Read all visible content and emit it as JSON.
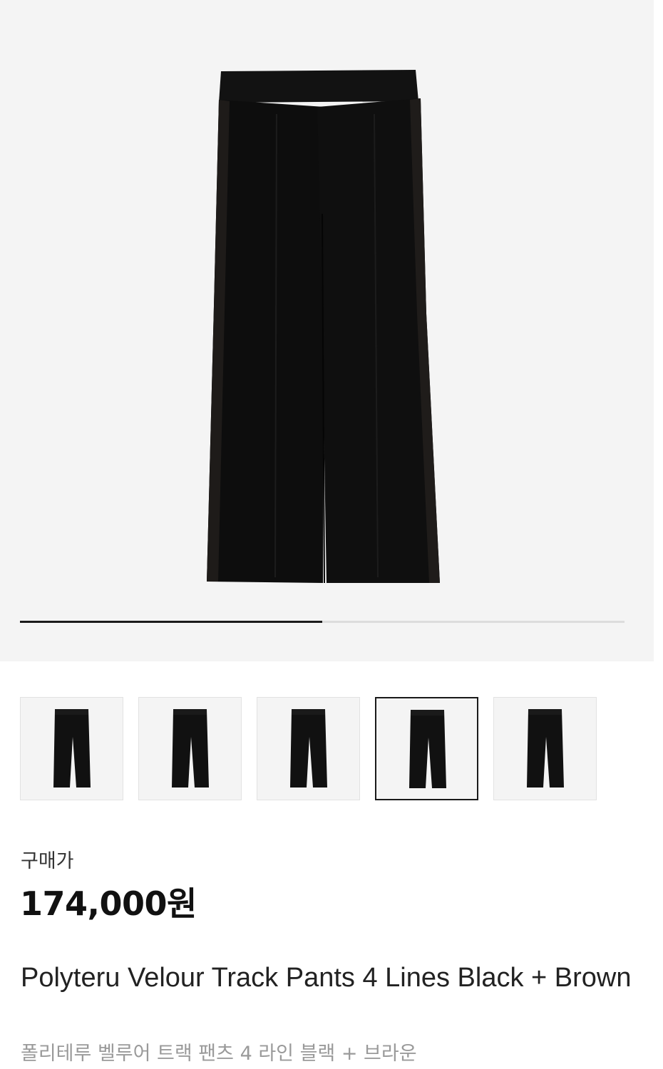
{
  "gallery": {
    "main_image_icon": "pants-product-photo",
    "progress": 0.5,
    "thumbnails": [
      {
        "icon": "pants-thumbnail",
        "selected": false
      },
      {
        "icon": "pants-thumbnail",
        "selected": false
      },
      {
        "icon": "pants-thumbnail",
        "selected": false
      },
      {
        "icon": "pants-thumbnail",
        "selected": true
      },
      {
        "icon": "pants-thumbnail",
        "selected": false
      }
    ]
  },
  "product": {
    "price_label": "구매가",
    "price": "174,000원",
    "title_en": "Polyteru Velour Track Pants 4 Lines Black + Brown",
    "title_ko": "폴리테루 벨루어 트랙 팬츠 4 라인 블랙 + 브라운"
  },
  "colors": {
    "hero_background": "#f4f4f4",
    "pants": "#111111",
    "progress_active": "#1a1a1a",
    "progress_inactive": "#dcdcdc",
    "secondary_text": "#9a9a9a"
  }
}
